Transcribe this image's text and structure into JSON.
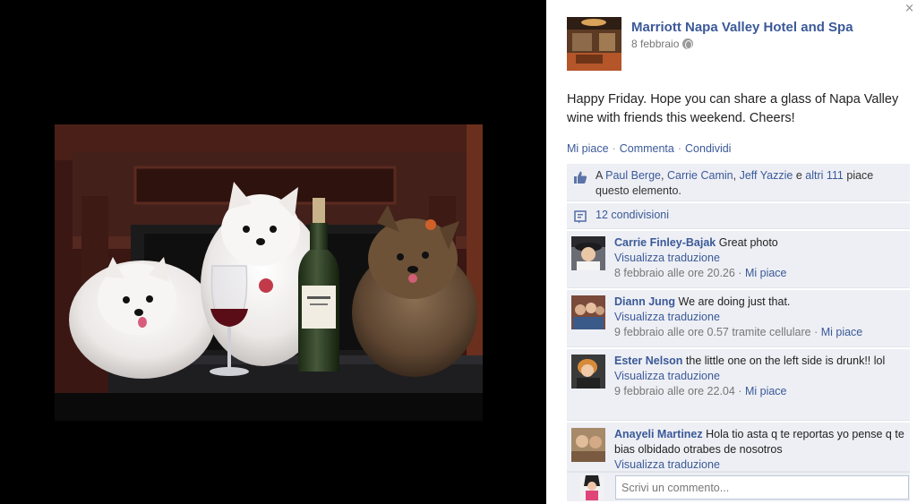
{
  "close_glyph": "×",
  "post": {
    "page_name": "Marriott Napa Valley Hotel and Spa",
    "date": "8 febbraio",
    "text": "Happy Friday. Hope you can share a glass of Napa Valley wine with friends this weekend. Cheers!"
  },
  "actions": {
    "like": "Mi piace",
    "sep1": "·",
    "comment": "Commenta",
    "sep2": "·",
    "share": "Condividi"
  },
  "likes": {
    "prefix": "A",
    "user1": "Paul Berge",
    "comma1": ",",
    "user2": "Carrie Camin",
    "comma2": ",",
    "user3": "Jeff Yazzie",
    "and": "e",
    "others": "altri 111",
    "suffix": "piace questo elemento."
  },
  "shares": {
    "label": "12 condivisioni"
  },
  "comments": [
    {
      "author": "Carrie Finley-Bajak",
      "text": "Great photo",
      "translate": "Visualizza traduzione",
      "timestamp": "8 febbraio alle ore 20.26",
      "sep": "·",
      "like": "Mi piace"
    },
    {
      "author": "Diann Jung",
      "text": "We are doing just that.",
      "translate": "Visualizza traduzione",
      "timestamp": "9 febbraio alle ore 0.57 tramite cellulare",
      "sep": "·",
      "like": "Mi piace"
    },
    {
      "author": "Ester Nelson",
      "text": "the little one on the left side is drunk!! lol",
      "translate": "Visualizza traduzione",
      "timestamp": "9 febbraio alle ore 22.04",
      "sep": "·",
      "like": "Mi piace"
    },
    {
      "author": "Anayeli Martinez",
      "text": "Hola tio asta q te reportas yo pense q te bias olbidado otrabes de nosotros",
      "translate": "Visualizza traduzione"
    }
  ],
  "compose": {
    "placeholder": "Scrivi un commento..."
  },
  "colors": {
    "link": "#3b5998",
    "ufi_bg": "#edeff4",
    "stage_bg": "#000000"
  }
}
